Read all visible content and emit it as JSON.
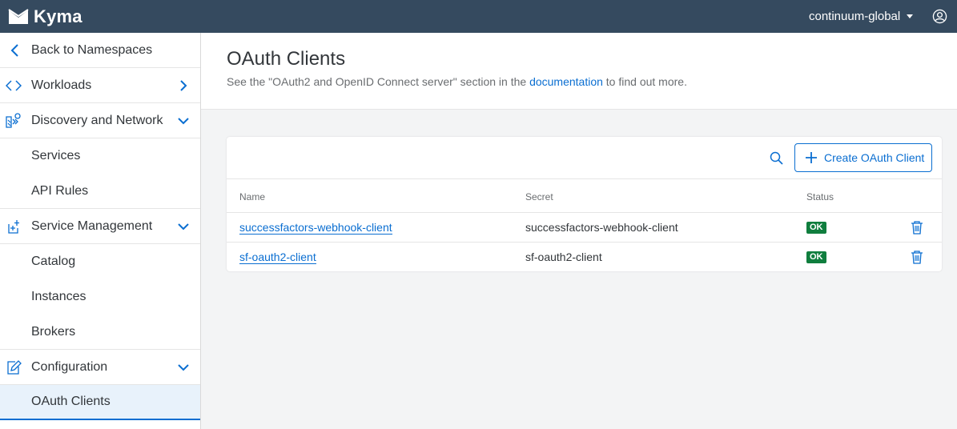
{
  "shell": {
    "app_name": "Kyma",
    "namespace": "continuum-global",
    "icons": {
      "logo": "kyma-logo-icon",
      "user": "user-account-icon",
      "caret": "caret-down-icon"
    }
  },
  "sidebar": {
    "back_label": "Back to Namespaces",
    "items": [
      {
        "label": "Workloads",
        "icon": "code-icon",
        "chevron": "chevron-right"
      },
      {
        "label": "Discovery and Network",
        "icon": "network-icon",
        "chevron": "chevron-down"
      },
      {
        "label": "Services"
      },
      {
        "label": "API Rules"
      },
      {
        "label": "Service Management",
        "icon": "service-icon",
        "chevron": "chevron-down"
      },
      {
        "label": "Catalog"
      },
      {
        "label": "Instances"
      },
      {
        "label": "Brokers"
      },
      {
        "label": "Configuration",
        "icon": "edit-icon",
        "chevron": "chevron-down"
      },
      {
        "label": "OAuth Clients",
        "selected": true
      }
    ]
  },
  "header": {
    "title": "OAuth Clients",
    "desc_before": "See the \"OAuth2 and OpenID Connect server\" section in the",
    "desc_link": "documentation",
    "desc_after": "to find out more."
  },
  "toolbar": {
    "create_label": "Create OAuth Client"
  },
  "table": {
    "columns": [
      "Name",
      "Secret",
      "Status"
    ],
    "rows": [
      {
        "name": "successfactors-webhook-client",
        "secret": "successfactors-webhook-client",
        "status": "OK"
      },
      {
        "name": "sf-oauth2-client",
        "secret": "sf-oauth2-client",
        "status": "OK"
      }
    ]
  },
  "colors": {
    "shell": "#354a5f",
    "accent": "#0a6ed1",
    "status_ok": "#107e3e"
  }
}
